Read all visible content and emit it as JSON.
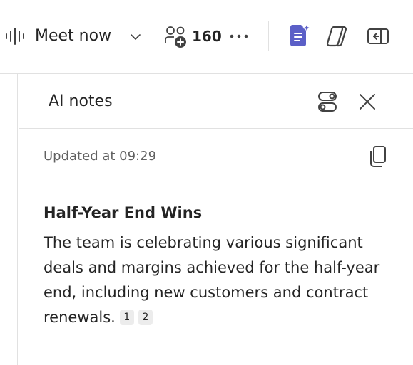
{
  "toolbar": {
    "meeting_title": "Meet now",
    "participants_count": "160",
    "icons": [
      "audio-waveform-icon",
      "chevron-down-icon",
      "people-add-icon",
      "more-icon",
      "ai-notes-icon",
      "copilot-icon",
      "panel-collapse-icon"
    ]
  },
  "notes_pane": {
    "title": "AI notes",
    "updated": "Updated at 09:29",
    "section": {
      "title": "Half-Year End Wins",
      "body": "The team is celebrating various significant deals and margins achieved for the half-year end, including new customers and contract renewals.",
      "citations": [
        "1",
        "2"
      ]
    }
  },
  "colors": {
    "accent": "#5b5fc7",
    "text": "#242424",
    "muted_text": "#616161",
    "divider": "#e1e1e1",
    "citation_bg": "#ececec"
  }
}
